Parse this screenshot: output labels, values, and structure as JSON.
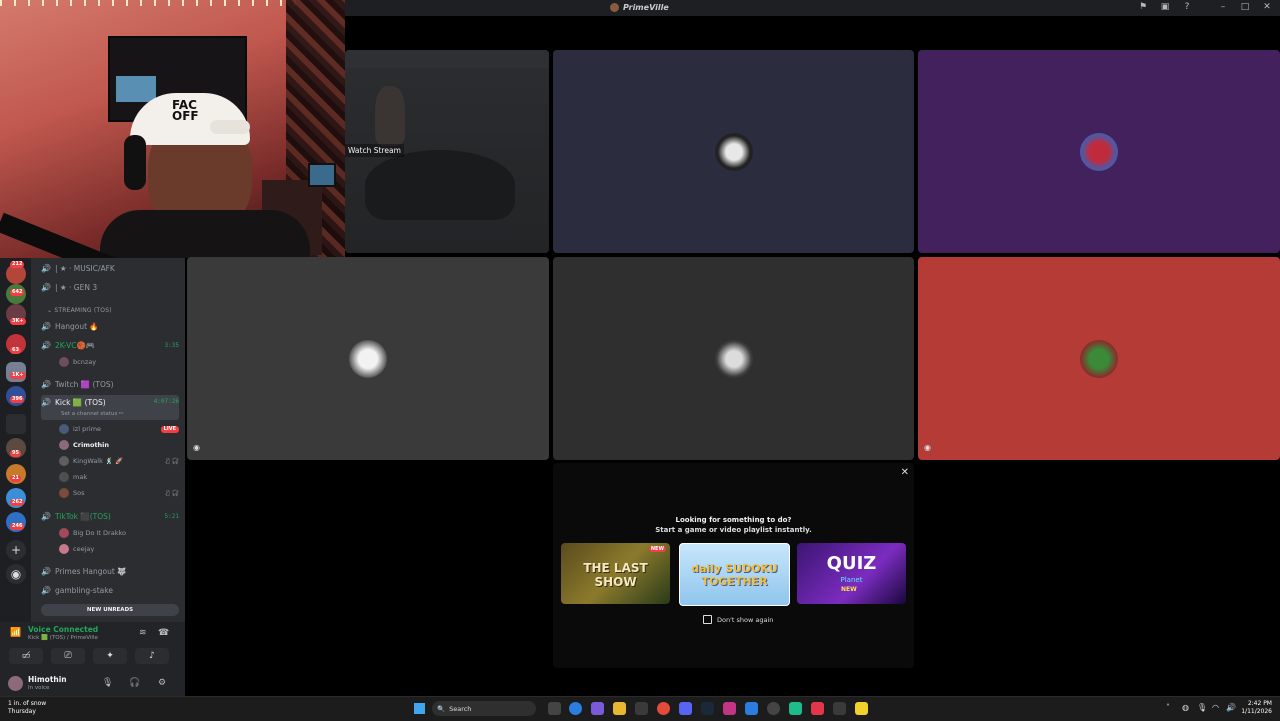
{
  "window": {
    "title": "PrimeVille"
  },
  "stream_tile": {
    "watch_label": "Watch Stream"
  },
  "channels": {
    "items": [
      {
        "label": "| ★ · MUSIC/AFK"
      },
      {
        "label": "| ★ · GEN 3"
      },
      {
        "label": "Hangout 🔥"
      },
      {
        "label": "2K-VC🏀🎮",
        "time": "3:35"
      },
      {
        "label": "Twitch 🟪 (TOS)"
      },
      {
        "label": "Kick 🟩 (TOS)",
        "time": "4:07:26",
        "sub": "Set a channel status ✏"
      },
      {
        "label": "TikTok ⬛(TOS)",
        "time": "5:21"
      },
      {
        "label": "Primes Hangout 🐺"
      },
      {
        "label": "gambling-stake"
      }
    ],
    "category": "STREAMING (TOS)",
    "users_2k": [
      "bcnzay"
    ],
    "users_kick": [
      {
        "name": "izl prime",
        "badge": "LIVE"
      },
      {
        "name": "Crimothin"
      },
      {
        "name": "KingWalk 🕺 🚀"
      },
      {
        "name": "mak"
      },
      {
        "name": "Sos"
      }
    ],
    "users_tiktok": [
      "Big Do It Drakko",
      "ceejay"
    ],
    "new_unreads": "NEW UNREADS"
  },
  "rail": {
    "badges": [
      "212",
      "642",
      "3K+",
      "63",
      "1K+",
      "396",
      "95",
      "21",
      "262",
      "246"
    ]
  },
  "voice": {
    "status": "Voice Connected",
    "location": "Kick 🟩 (TOS) / PrimeVille"
  },
  "user": {
    "name": "Himothin",
    "status": "In voice"
  },
  "activity": {
    "line1": "Looking for something to do?",
    "line2": "Start a game or video playlist instantly.",
    "games": [
      {
        "title": "THE LAST SHOW",
        "badge": "NEW"
      },
      {
        "title": "daily SUDOKU TOGETHER"
      },
      {
        "title": "QUIZ",
        "subtitle": "Planet",
        "tag": "NEW"
      }
    ],
    "dont_show": "Don't show again"
  },
  "taskbar": {
    "weather_line1": "1 in. of snow",
    "weather_line2": "Thursday",
    "search": "Search",
    "time": "2:42 PM",
    "date": "1/11/2026"
  },
  "colors": {
    "tile_slate": "#2b2d3e",
    "tile_purple": "#43215c",
    "tile_gray": "#3a3a3a",
    "tile_red": "#b53b37",
    "accent_green": "#23a55a"
  }
}
